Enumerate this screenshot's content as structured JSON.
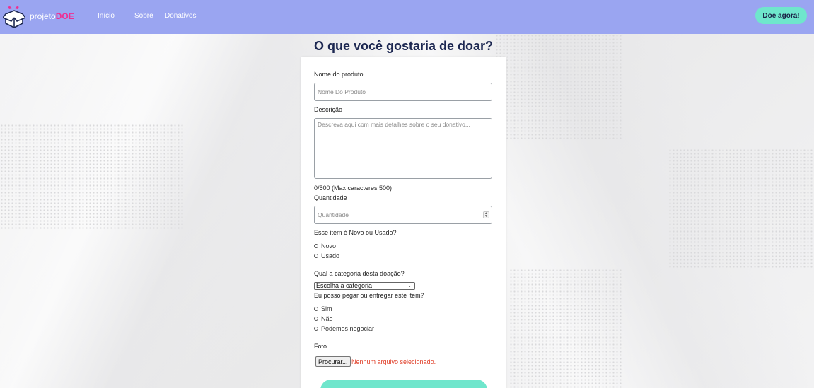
{
  "nav": {
    "brand_prefix": "projeto",
    "brand_suffix": "DOE",
    "links": [
      "Início",
      "Sobre",
      "Donativos"
    ],
    "cta": "Doe agora!",
    "logo_icon": "gift-box-icon",
    "colors": {
      "bar": "#9aa5f1",
      "cta": "#6fe6cc",
      "brand_accent": "#ef2f92"
    }
  },
  "page": {
    "title": "O que você gostaria de doar?"
  },
  "form": {
    "product_name": {
      "label": "Nome do produto",
      "placeholder": "Nome Do Produto",
      "value": ""
    },
    "description": {
      "label": "Descrição",
      "placeholder": "Descreva aqui com mais detalhes sobre o seu donativo...",
      "value": ""
    },
    "counter": "0/500 (Max caracteres 500)",
    "quantity": {
      "label": "Quantidade",
      "placeholder": "Quantidade",
      "value": ""
    },
    "condition": {
      "question": "Esse item é Novo ou Usado?",
      "options": [
        "Novo",
        "Usado"
      ]
    },
    "category": {
      "question": "Qual a categoria desta doação?",
      "selected": "Escolha a categoria"
    },
    "delivery": {
      "question": "Eu posso pegar ou entregar este item?",
      "options": [
        "Sim",
        "Não",
        "Podemos negociar"
      ]
    },
    "photo": {
      "label": "Foto",
      "button": "Procurar...",
      "status": "Nenhum arquivo selecionado."
    },
    "submit_color": "#6fe6cc"
  }
}
